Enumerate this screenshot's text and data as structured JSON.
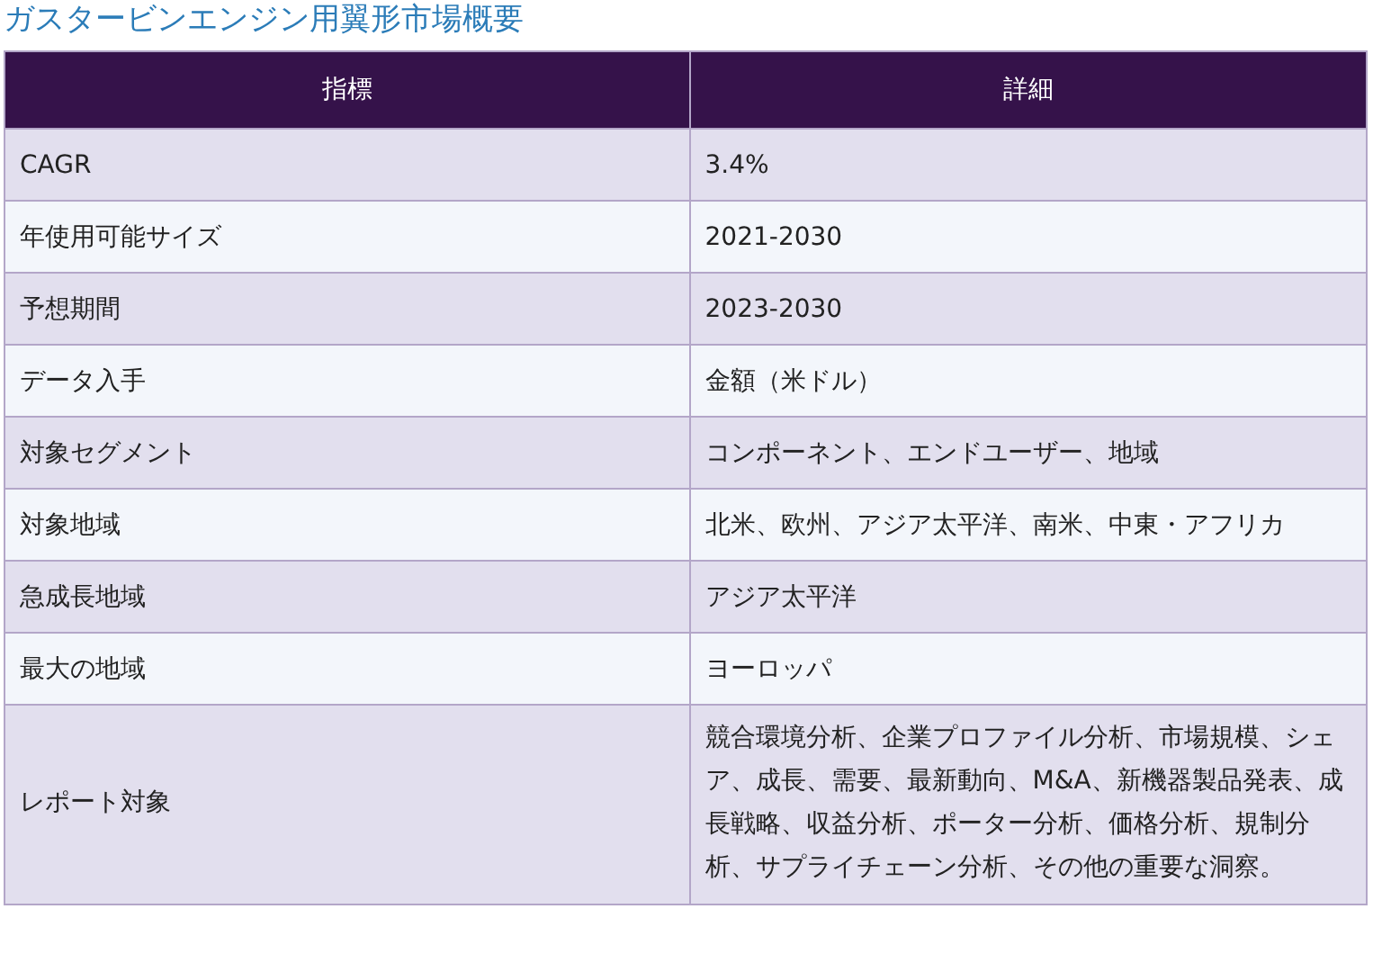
{
  "title": "ガスタービンエンジン用翼形市場概要",
  "table": {
    "columns": [
      "指標",
      "詳細"
    ],
    "rows": [
      {
        "metric": "CAGR",
        "detail": "3.4%"
      },
      {
        "metric": "年使用可能サイズ",
        "detail": "2021-2030"
      },
      {
        "metric": "予想期間",
        "detail": "2023-2030"
      },
      {
        "metric": "データ入手",
        "detail": "金額（米ドル）"
      },
      {
        "metric": "対象セグメント",
        "detail": "コンポーネント、エンドユーザー、地域"
      },
      {
        "metric": "対象地域",
        "detail": "北米、欧州、アジア太平洋、南米、中東・アフリカ"
      },
      {
        "metric": "急成長地域",
        "detail": "アジア太平洋"
      },
      {
        "metric": "最大の地域",
        "detail": "ヨーロッパ"
      },
      {
        "metric": "レポート対象",
        "detail": "競合環境分析、企業プロファイル分析、市場規模、シェア、成長、需要、最新動向、M&A、新機器製品発表、成長戦略、収益分析、ポーター分析、価格分析、規制分析、サプライチェーン分析、その他の重要な洞察。"
      }
    ]
  }
}
